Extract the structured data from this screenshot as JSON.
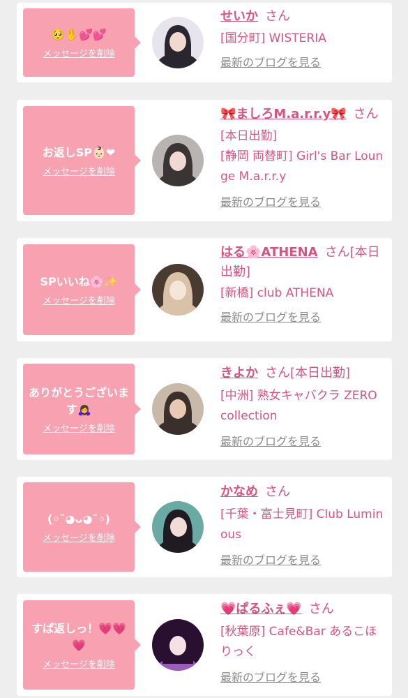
{
  "messages": [
    {
      "message": "🥺✋💕💕",
      "delete_label": "メッセージを削除",
      "name": "せいか",
      "honorific": "さん",
      "status": "",
      "shop": "[国分町] WISTERIA",
      "blog_label": "最新のブログを見る",
      "avatar_colors": [
        "#e8e4ee",
        "#2a2630",
        "#f1d9cf"
      ]
    },
    {
      "message": "お返しSP👶🏻❤",
      "delete_label": "メッセージを削除",
      "name": "🎀ましろM.a.r.r.y🎀",
      "honorific": "さん",
      "status": "[本日出勤]",
      "shop": "[静岡 両替町] Girl's Bar Lounge M.a.r.r.y",
      "blog_label": "最新のブログを見る",
      "avatar_colors": [
        "#b9b4b2",
        "#3b3434",
        "#efd9d2"
      ]
    },
    {
      "message": "SPいいね🌸✨",
      "delete_label": "メッセージを削除",
      "name": "はる🌸ATHENA",
      "honorific": "さん",
      "status": "[本日出勤]",
      "shop": "[新橋] club ATHENA",
      "blog_label": "最新のブログを見る",
      "avatar_colors": [
        "#4a3b30",
        "#d9c2a8",
        "#f5e6da"
      ]
    },
    {
      "message": "ありがとうございます🙇‍♀️",
      "delete_label": "メッセージを削除",
      "name": "きよか",
      "honorific": "さん",
      "status": "[本日出勤]",
      "shop": "[中洲] 熟女キャバクラ ZERO collection",
      "blog_label": "最新のブログを見る",
      "avatar_colors": [
        "#c9b9a9",
        "#3a2f2a",
        "#e9c9b4"
      ]
    },
    {
      "message": "(◦ˉ◕ᴗ◕ˉ◦)",
      "delete_label": "メッセージを削除",
      "name": "かなめ",
      "honorific": "さん",
      "status": "",
      "shop": "[千葉・富士見町] Club Luminous",
      "blog_label": "最新のブログを見る",
      "avatar_colors": [
        "#6aa9a4",
        "#1e1c22",
        "#f2ddd6"
      ]
    },
    {
      "message": "すぱ返しっ！💗💗💗",
      "delete_label": "メッセージを削除",
      "name": "💗ぱるふぇ💗",
      "honorific": "さん",
      "status": "",
      "shop": "[秋葉原] Cafe&Bar あるこほりっく",
      "blog_label": "最新のブログを見る",
      "avatar_colors": [
        "#2a1030",
        "#9b5bbf",
        "#f3e1e6"
      ]
    }
  ]
}
